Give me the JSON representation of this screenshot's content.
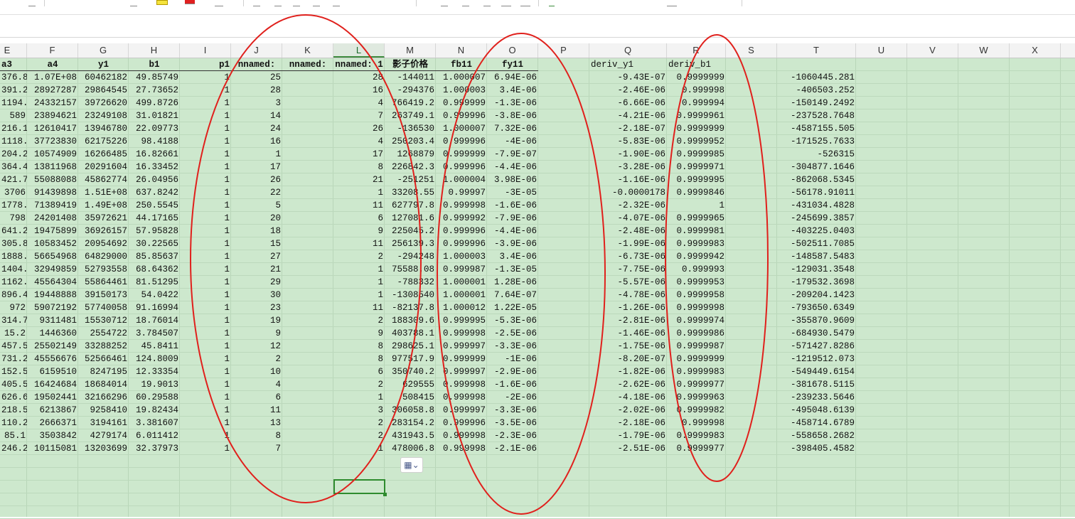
{
  "columns": [
    {
      "letter": "E",
      "w": 55
    },
    {
      "letter": "F",
      "w": 72
    },
    {
      "letter": "G",
      "w": 71
    },
    {
      "letter": "H",
      "w": 72
    },
    {
      "letter": "I",
      "w": 72
    },
    {
      "letter": "J",
      "w": 72
    },
    {
      "letter": "K",
      "w": 72
    },
    {
      "letter": "L",
      "w": 72
    },
    {
      "letter": "M",
      "w": 72
    },
    {
      "letter": "N",
      "w": 72
    },
    {
      "letter": "O",
      "w": 72
    },
    {
      "letter": "P",
      "w": 72
    },
    {
      "letter": "Q",
      "w": 109
    },
    {
      "letter": "R",
      "w": 83
    },
    {
      "letter": "S",
      "w": 72
    },
    {
      "letter": "T",
      "w": 111
    },
    {
      "letter": "U",
      "w": 72
    },
    {
      "letter": "V",
      "w": 72
    },
    {
      "letter": "W",
      "w": 72
    },
    {
      "letter": "X",
      "w": 72
    }
  ],
  "active_column": "L",
  "sheet": {
    "headers": [
      {
        "col": 0,
        "text": "a3",
        "align": "l"
      },
      {
        "col": 1,
        "text": "a4"
      },
      {
        "col": 2,
        "text": "y1"
      },
      {
        "col": 3,
        "text": "b1"
      },
      {
        "col": 4,
        "text": "p1",
        "align": "r"
      },
      {
        "col": 5,
        "text": "nnamed:"
      },
      {
        "col": 6,
        "text": "nnamed:"
      },
      {
        "col": 7,
        "text": "nnamed: 1"
      },
      {
        "col": 8,
        "text": "影子价格"
      },
      {
        "col": 9,
        "text": "fb11"
      },
      {
        "col": 10,
        "text": "fy11"
      },
      {
        "col": 12,
        "text": "deriv_y1",
        "plain": true
      },
      {
        "col": 13,
        "text": "deriv_b1",
        "plain": true
      }
    ],
    "rows": [
      [
        "376.8",
        "1.07E+08",
        "60462182",
        "49.85749",
        "1",
        "25",
        "",
        "28",
        "-144011",
        "1.000007",
        "6.94E-06",
        "",
        "-9.43E-07",
        "0.9999999",
        "",
        "-1060445.281"
      ],
      [
        "391.2",
        "28927287",
        "29864545",
        "27.73652",
        "1",
        "28",
        "",
        "16",
        "-294376",
        "1.000003",
        "3.4E-06",
        "",
        "-2.46E-06",
        "0.999998",
        "",
        "-406503.252"
      ],
      [
        "1194.2",
        "24332157",
        "39726620",
        "499.8726",
        "1",
        "3",
        "",
        "4",
        "766419.2",
        "0.999999",
        "-1.3E-06",
        "",
        "-6.66E-06",
        "0.999994",
        "",
        "-150149.2492"
      ],
      [
        "589",
        "23894621",
        "23249108",
        "31.01821",
        "1",
        "14",
        "",
        "7",
        "263749.1",
        "0.999996",
        "-3.8E-06",
        "",
        "-4.21E-06",
        "0.9999961",
        "",
        "-237528.7648"
      ],
      [
        "216.1",
        "12610417",
        "13946780",
        "22.09773",
        "1",
        "24",
        "",
        "26",
        "-136530",
        "1.000007",
        "7.32E-06",
        "",
        "-2.18E-07",
        "0.9999999",
        "",
        "-4587155.505"
      ],
      [
        "1118.5",
        "37723830",
        "62175226",
        "98.4188",
        "1",
        "16",
        "",
        "4",
        "250203.4",
        "0.999996",
        "-4E-06",
        "",
        "-5.83E-06",
        "0.9999952",
        "",
        "-171525.7633"
      ],
      [
        "204.2",
        "10574909",
        "16266485",
        "16.82661",
        "1",
        "1",
        "",
        "17",
        "1268879",
        "0.999999",
        "-7.9E-07",
        "",
        "-1.90E-06",
        "0.9999985",
        "",
        "-526315"
      ],
      [
        "364.4",
        "13811968",
        "20291604",
        "16.33452",
        "1",
        "17",
        "",
        "8",
        "226842.3",
        "0.999996",
        "-4.4E-06",
        "",
        "-3.28E-06",
        "0.9999971",
        "",
        "-304877.1646"
      ],
      [
        "421.7",
        "55088088",
        "45862774",
        "26.04956",
        "1",
        "26",
        "",
        "21",
        "-251251",
        "1.000004",
        "3.98E-06",
        "",
        "-1.16E-06",
        "0.9999995",
        "",
        "-862068.5345"
      ],
      [
        "3706",
        "91439898",
        "1.51E+08",
        "637.8242",
        "1",
        "22",
        "",
        "1",
        "33208.55",
        "0.99997",
        "-3E-05",
        "",
        "-0.0000178",
        "0.9999846",
        "",
        "-56178.91011"
      ],
      [
        "1778.3",
        "71389419",
        "1.49E+08",
        "250.5545",
        "1",
        "5",
        "",
        "11",
        "627797.8",
        "0.999998",
        "-1.6E-06",
        "",
        "-2.32E-06",
        "1",
        "",
        "-431034.4828"
      ],
      [
        "798",
        "24201408",
        "35972621",
        "44.17165",
        "1",
        "20",
        "",
        "6",
        "127081.6",
        "0.999992",
        "-7.9E-06",
        "",
        "-4.07E-06",
        "0.9999965",
        "",
        "-245699.3857"
      ],
      [
        "641.2",
        "19475899",
        "36926157",
        "57.95828",
        "1",
        "18",
        "",
        "9",
        "225045.2",
        "0.999996",
        "-4.4E-06",
        "",
        "-2.48E-06",
        "0.9999981",
        "",
        "-403225.0403"
      ],
      [
        "305.8",
        "10583452",
        "20954692",
        "30.22565",
        "1",
        "15",
        "",
        "11",
        "256139.3",
        "0.999996",
        "-3.9E-06",
        "",
        "-1.99E-06",
        "0.9999983",
        "",
        "-502511.7085"
      ],
      [
        "1888.7",
        "56654968",
        "64829000",
        "85.85637",
        "1",
        "27",
        "",
        "2",
        "-294248",
        "1.000003",
        "3.4E-06",
        "",
        "-6.73E-06",
        "0.9999942",
        "",
        "-148587.5483"
      ],
      [
        "1404.9",
        "32949859",
        "52793558",
        "68.64362",
        "1",
        "21",
        "",
        "1",
        "75588.08",
        "0.999987",
        "-1.3E-05",
        "",
        "-7.75E-06",
        "0.999993",
        "",
        "-129031.3548"
      ],
      [
        "1162.1",
        "45564304",
        "55864461",
        "81.51295",
        "1",
        "29",
        "",
        "1",
        "-788332",
        "1.000001",
        "1.28E-06",
        "",
        "-5.57E-06",
        "0.9999953",
        "",
        "-179532.3698"
      ],
      [
        "896.4",
        "19448888",
        "39150173",
        "54.0422",
        "1",
        "30",
        "",
        "1",
        "-1308540",
        "1.000001",
        "7.64E-07",
        "",
        "-4.78E-06",
        "0.9999958",
        "",
        "-209204.1423"
      ],
      [
        "972",
        "59072192",
        "57740058",
        "91.16994",
        "1",
        "23",
        "",
        "11",
        "-82137.8",
        "1.000012",
        "1.22E-05",
        "",
        "-1.26E-06",
        "0.9999998",
        "",
        "-793650.6349"
      ],
      [
        "314.7",
        "9311481",
        "15530712",
        "18.76014",
        "1",
        "19",
        "",
        "2",
        "188309.6",
        "0.999995",
        "-5.3E-06",
        "",
        "-2.81E-06",
        "0.9999974",
        "",
        "-355870.9609"
      ],
      [
        "15.2",
        "1446360",
        "2554722",
        "3.784507",
        "1",
        "9",
        "",
        "9",
        "403788.1",
        "0.999998",
        "-2.5E-06",
        "",
        "-1.46E-06",
        "0.9999986",
        "",
        "-684930.5479"
      ],
      [
        "457.5",
        "25502149",
        "33288252",
        "45.8411",
        "1",
        "12",
        "",
        "8",
        "298625.1",
        "0.999997",
        "-3.3E-06",
        "",
        "-1.75E-06",
        "0.9999987",
        "",
        "-571427.8286"
      ],
      [
        "731.2",
        "45556676",
        "52566461",
        "124.8009",
        "1",
        "2",
        "",
        "8",
        "977517.9",
        "0.999999",
        "-1E-06",
        "",
        "-8.20E-07",
        "0.9999999",
        "",
        "-1219512.073"
      ],
      [
        "152.5",
        "6159510",
        "8247195",
        "12.33354",
        "1",
        "10",
        "",
        "6",
        "350740.2",
        "0.999997",
        "-2.9E-06",
        "",
        "-1.82E-06",
        "0.9999983",
        "",
        "-549449.6154"
      ],
      [
        "405.5",
        "16424684",
        "18684014",
        "19.9013",
        "1",
        "4",
        "",
        "2",
        "629555",
        "0.999998",
        "-1.6E-06",
        "",
        "-2.62E-06",
        "0.9999977",
        "",
        "-381678.5115"
      ],
      [
        "626.6",
        "19502441",
        "32166296",
        "60.29588",
        "1",
        "6",
        "",
        "1",
        "508415",
        "0.999998",
        "-2E-06",
        "",
        "-4.18E-06",
        "0.9999963",
        "",
        "-239233.5646"
      ],
      [
        "218.5",
        "6213867",
        "9258410",
        "19.82434",
        "1",
        "11",
        "",
        "3",
        "306058.8",
        "0.999997",
        "-3.3E-06",
        "",
        "-2.02E-06",
        "0.9999982",
        "",
        "-495048.6139"
      ],
      [
        "110.2",
        "2666371",
        "3194161",
        "3.381607",
        "1",
        "13",
        "",
        "2",
        "283154.2",
        "0.999996",
        "-3.5E-06",
        "",
        "-2.18E-06",
        "0.999998",
        "",
        "-458714.6789"
      ],
      [
        "85.1",
        "3503842",
        "4279174",
        "6.011412",
        "1",
        "8",
        "",
        "2",
        "431943.5",
        "0.999998",
        "-2.3E-06",
        "",
        "-1.79E-06",
        "0.9999983",
        "",
        "-558658.2682"
      ],
      [
        "246.2",
        "10115081",
        "13203699",
        "32.37973",
        "1",
        "7",
        "",
        "1",
        "478006.8",
        "0.999998",
        "-2.1E-06",
        "",
        "-2.51E-06",
        "0.9999977",
        "",
        "-398405.4582"
      ]
    ]
  },
  "selection": {
    "cell": "L31"
  },
  "paste_options": {
    "icon": "paste-options-icon",
    "caret": "⌄"
  },
  "annotation_color": "#e0201c"
}
